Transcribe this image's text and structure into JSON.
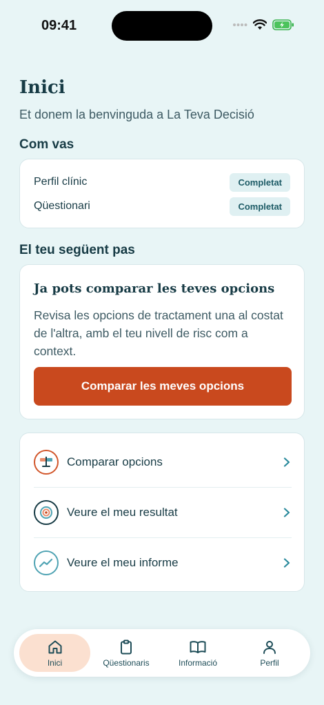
{
  "status": {
    "time": "09:41"
  },
  "home": {
    "title": "Inici",
    "subtitle": "Et donem la benvinguda a La Teva Decisió"
  },
  "progress": {
    "title": "Com vas",
    "items": [
      {
        "label": "Perfil clínic",
        "status": "Completat"
      },
      {
        "label": "Qüestionari",
        "status": "Completat"
      }
    ]
  },
  "next_step": {
    "title": "El teu següent pas",
    "heading": "Ja pots comparar les teves opcions",
    "body": "Revisa les opcions de tractament una al costat de l'altra, amb el teu nivell de risc com a context.",
    "button": "Comparar les meves opcions"
  },
  "actions": [
    {
      "label": "Comparar opcions",
      "icon": "scale-icon"
    },
    {
      "label": "Veure el meu resultat",
      "icon": "target-icon"
    },
    {
      "label": "Veure el meu informe",
      "icon": "trend-chart-icon"
    }
  ],
  "tabs": [
    {
      "label": "Inici",
      "icon": "home-icon",
      "active": true
    },
    {
      "label": "Qüestionaris",
      "icon": "clipboard-icon",
      "active": false
    },
    {
      "label": "Informació",
      "icon": "book-icon",
      "active": false
    },
    {
      "label": "Perfil",
      "icon": "user-icon",
      "active": false
    }
  ],
  "colors": {
    "background": "#e8f5f6",
    "accent": "#c9491e",
    "text": "#173b45",
    "badge_bg": "#dff0f2",
    "active_tab": "#fbe0d0"
  }
}
